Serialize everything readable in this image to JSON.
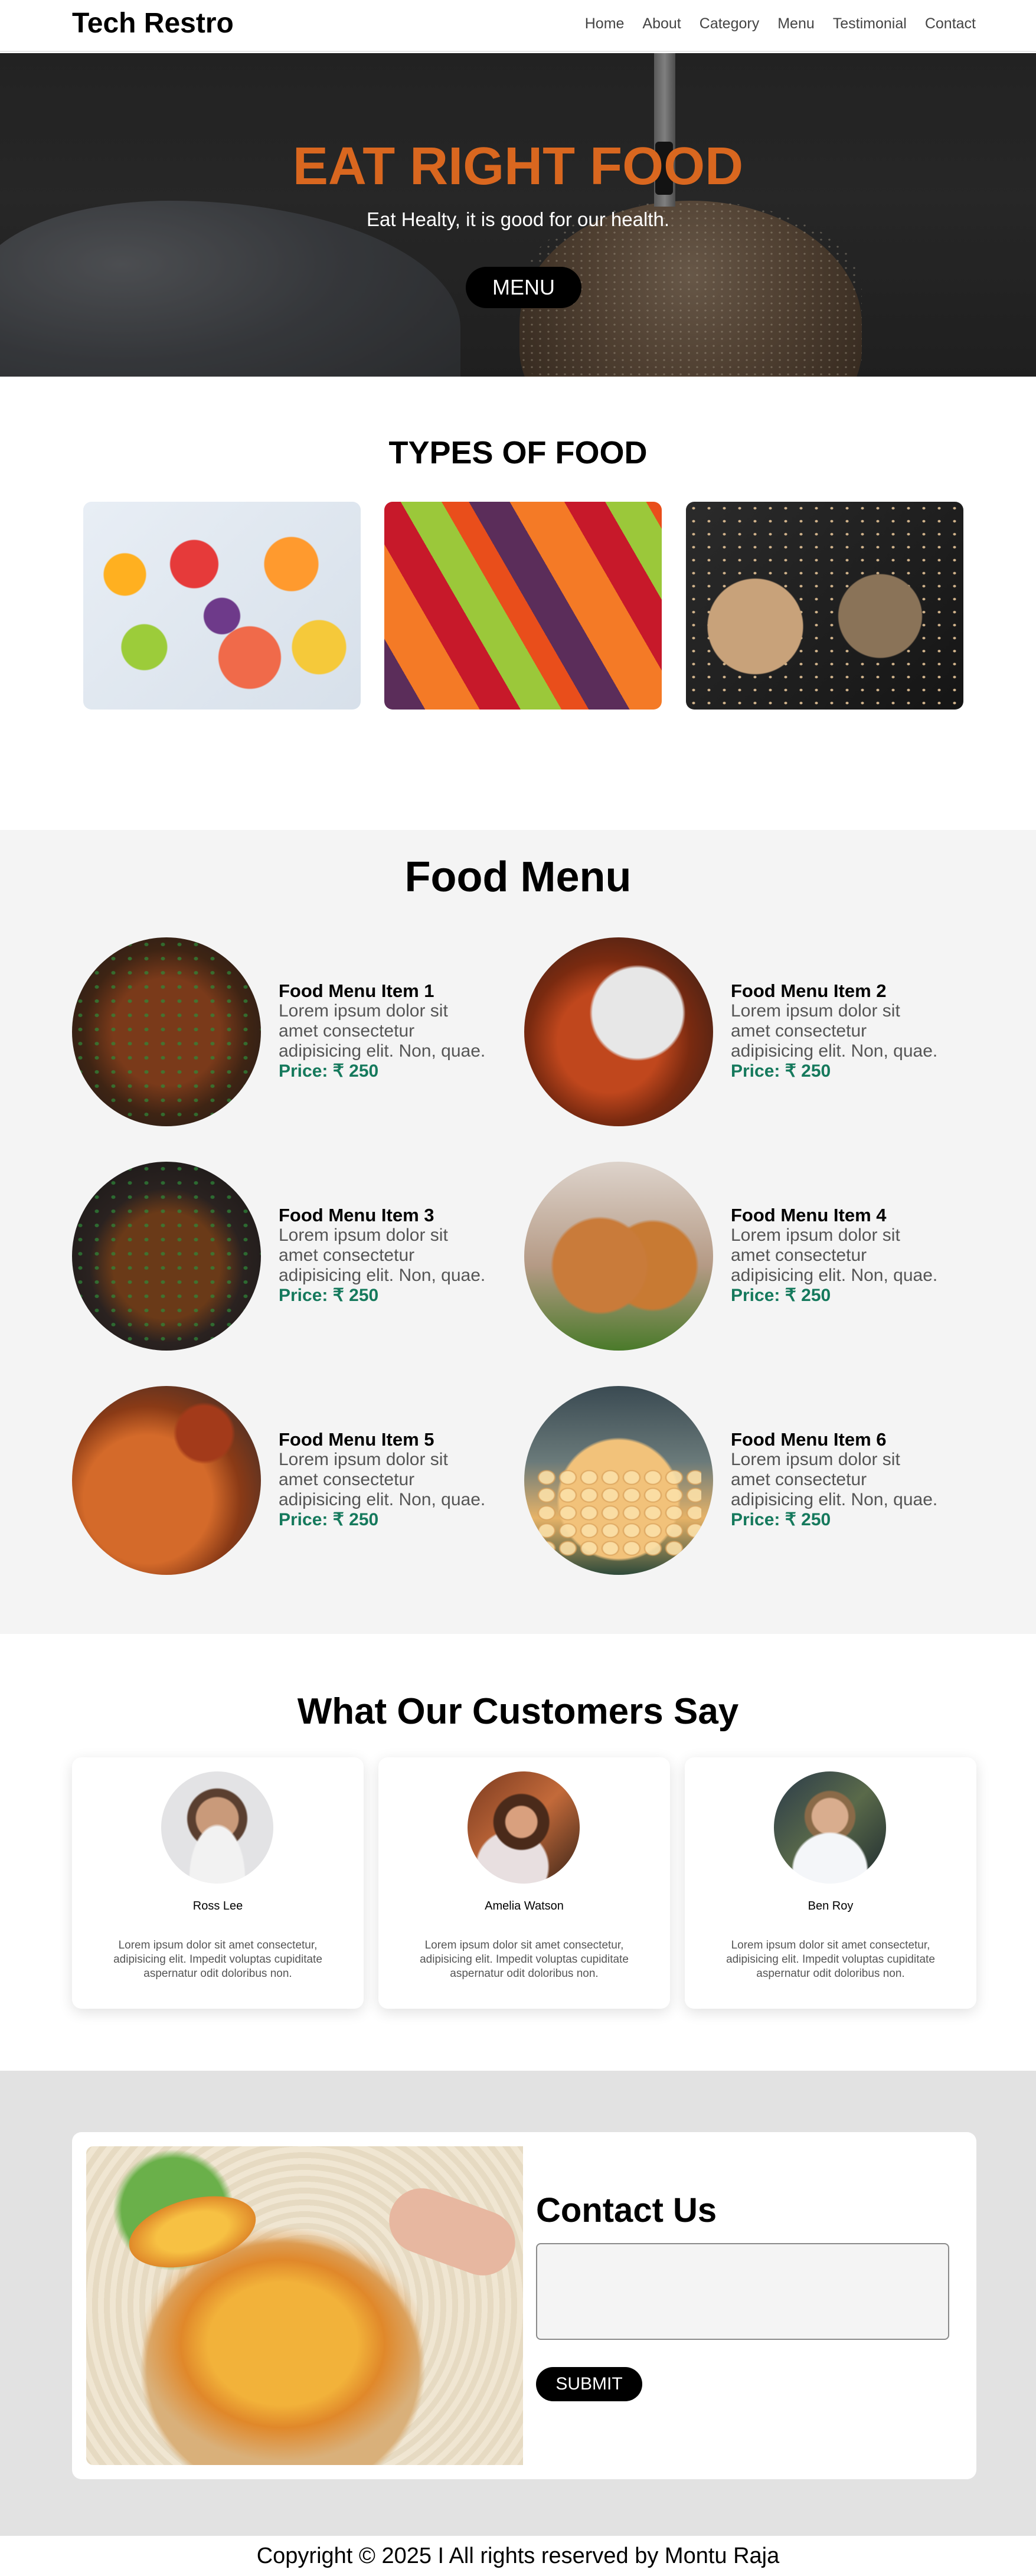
{
  "nav": {
    "brand": "Tech Restro",
    "links": [
      "Home",
      "About",
      "Category",
      "Menu",
      "Testimonial",
      "Contact"
    ]
  },
  "hero": {
    "title": "EAT RIGHT FOOD",
    "subtitle": "Eat Healty, it is good for our health.",
    "button": "MENU",
    "colors": {
      "title": "#d9671f",
      "button_bg": "#000000"
    }
  },
  "types": {
    "title": "TYPES OF FOOD"
  },
  "menu": {
    "title": "Food Menu",
    "items": [
      {
        "name": "Food Menu Item 1",
        "desc": "Lorem ipsum dolor sit amet consectetur adipisicing elit. Non, quae.",
        "price": "Price: ₹ 250"
      },
      {
        "name": "Food Menu Item 2",
        "desc": "Lorem ipsum dolor sit amet consectetur adipisicing elit. Non, quae.",
        "price": "Price: ₹ 250"
      },
      {
        "name": "Food Menu Item 3",
        "desc": "Lorem ipsum dolor sit amet consectetur adipisicing elit. Non, quae.",
        "price": "Price: ₹ 250"
      },
      {
        "name": "Food Menu Item 4",
        "desc": "Lorem ipsum dolor sit amet consectetur adipisicing elit. Non, quae.",
        "price": "Price: ₹ 250"
      },
      {
        "name": "Food Menu Item 5",
        "desc": "Lorem ipsum dolor sit amet consectetur adipisicing elit. Non, quae.",
        "price": "Price: ₹ 250"
      },
      {
        "name": "Food Menu Item 6",
        "desc": "Lorem ipsum dolor sit amet consectetur adipisicing elit. Non, quae.",
        "price": "Price: ₹ 250"
      }
    ],
    "colors": {
      "price": "#15795c",
      "section_bg": "#f4f4f4"
    }
  },
  "testimonials": {
    "title": "What Our Customers Say",
    "items": [
      {
        "name": "Ross Lee",
        "text": "Lorem ipsum dolor sit amet consectetur, adipisicing elit. Impedit voluptas cupiditate aspernatur odit doloribus non."
      },
      {
        "name": "Amelia Watson",
        "text": "Lorem ipsum dolor sit amet consectetur, adipisicing elit. Impedit voluptas cupiditate aspernatur odit doloribus non."
      },
      {
        "name": "Ben Roy",
        "text": "Lorem ipsum dolor sit amet consectetur, adipisicing elit. Impedit voluptas cupiditate aspernatur odit doloribus non."
      }
    ]
  },
  "contact": {
    "title": "Contact Us",
    "input_value": "",
    "submit": "SUBMIT",
    "colors": {
      "section_bg": "#e2e2e2"
    }
  },
  "footer": {
    "copyright": "Copyright © 2025 I All rights reserved by Montu Raja"
  }
}
